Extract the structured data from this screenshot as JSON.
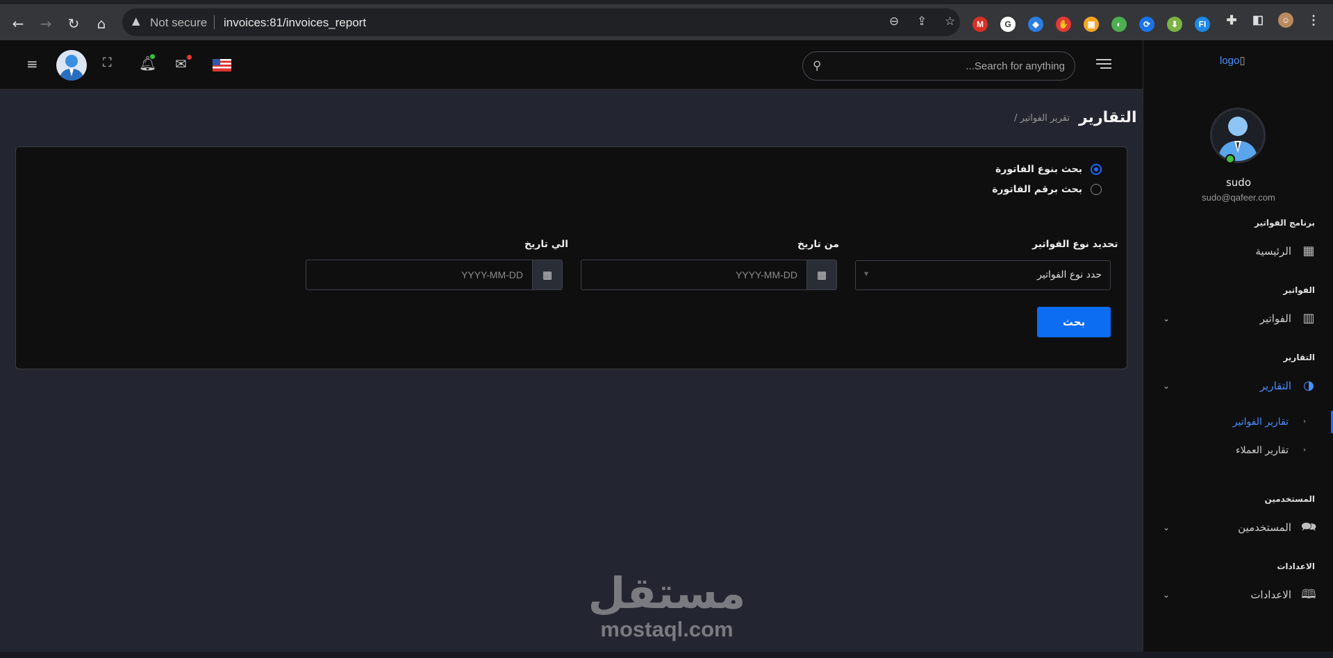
{
  "browser": {
    "security_label": "Not secure",
    "url": "invoices:81/invoices_report",
    "extensions": [
      {
        "name": "m-ext",
        "glyph": "M",
        "color": "#d93025"
      },
      {
        "name": "g-ext",
        "glyph": "G",
        "color": "#ffffff"
      },
      {
        "name": "gem-ext",
        "glyph": "◆",
        "color": "#2a7de1"
      },
      {
        "name": "stop-ext",
        "glyph": "✋",
        "color": "#e53935"
      },
      {
        "name": "box-ext",
        "glyph": "▣",
        "color": "#f5a623"
      },
      {
        "name": "globe-ext",
        "glyph": "◐",
        "color": "#4caf50"
      },
      {
        "name": "sync-ext",
        "glyph": "⟳",
        "color": "#1a73e8"
      },
      {
        "name": "download-ext",
        "glyph": "⬇",
        "color": "#7cb342"
      },
      {
        "name": "fi-ext",
        "glyph": "FI",
        "color": "#1e88e5"
      }
    ]
  },
  "header": {
    "search_placeholder": "...Search for anything"
  },
  "sidebar": {
    "logo_text": "logo",
    "user_name": "sudo",
    "user_email": "sudo@qafeer.com",
    "sections": {
      "invoices_program": "برنامج الفواتير",
      "invoices": "الفواتير",
      "reports": "التقارير",
      "users": "المستخدمين",
      "settings": "الاعدادات"
    },
    "items": {
      "home": "الرئيسية",
      "invoices": "الفواتير",
      "reports": "التقارير",
      "users": "المستخدمين",
      "settings": "الاعدادات"
    },
    "sub_items": {
      "invoice_reports": "تقارير الفواتير",
      "customer_reports": "تقارير العملاء"
    }
  },
  "page": {
    "title": "التقارير",
    "breadcrumb": "/ تقرير الفواتير"
  },
  "form": {
    "radio_type": "بحث بنوع الفاتورة",
    "radio_number": "بحث برقم الفاتورة",
    "type_label": "تحديد نوع الفواتير",
    "type_placeholder": "حدد نوع الفواتير",
    "from_label": "من تاريخ",
    "to_label": "الي تاريخ",
    "date_placeholder": "YYYY-MM-DD",
    "search_button": "بحث"
  },
  "watermark": {
    "arabic": "مستقل",
    "latin": "mostaql.com"
  }
}
